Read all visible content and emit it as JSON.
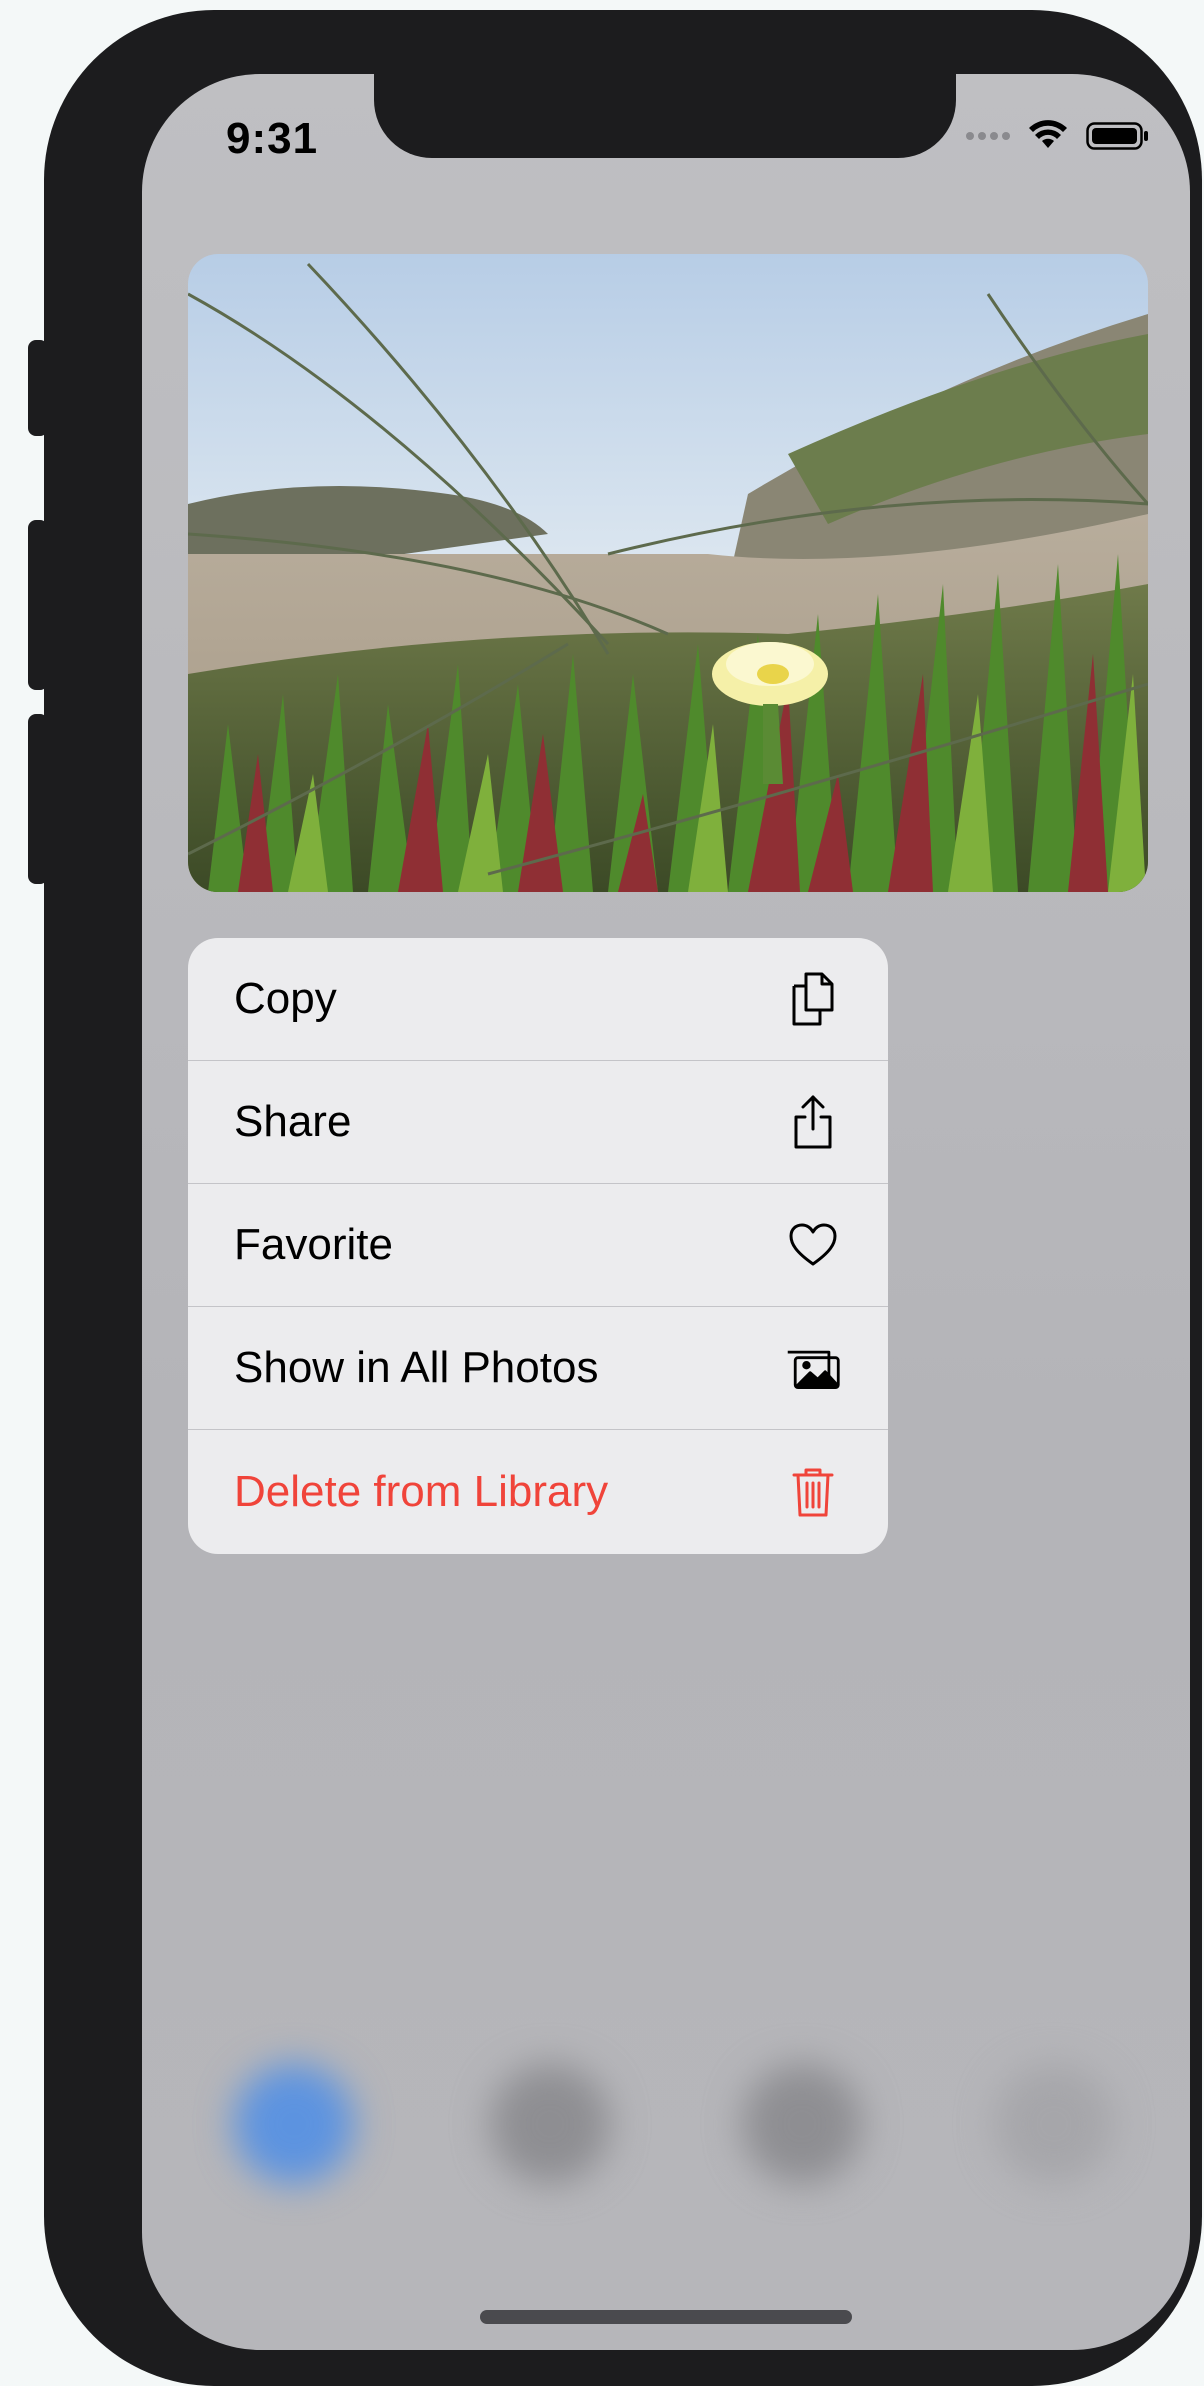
{
  "status_bar": {
    "time": "9:31"
  },
  "menu": {
    "items": [
      {
        "label": "Copy",
        "icon": "copy-icon"
      },
      {
        "label": "Share",
        "icon": "share-icon"
      },
      {
        "label": "Favorite",
        "icon": "heart-icon"
      },
      {
        "label": "Show in All Photos",
        "icon": "photos-icon"
      },
      {
        "label": "Delete from Library",
        "icon": "trash-icon",
        "color": "#f0443a"
      }
    ]
  },
  "colors": {
    "destructive": "#f0443a",
    "menu_background": "#ececee",
    "device_frame": "#1c1c1e"
  }
}
